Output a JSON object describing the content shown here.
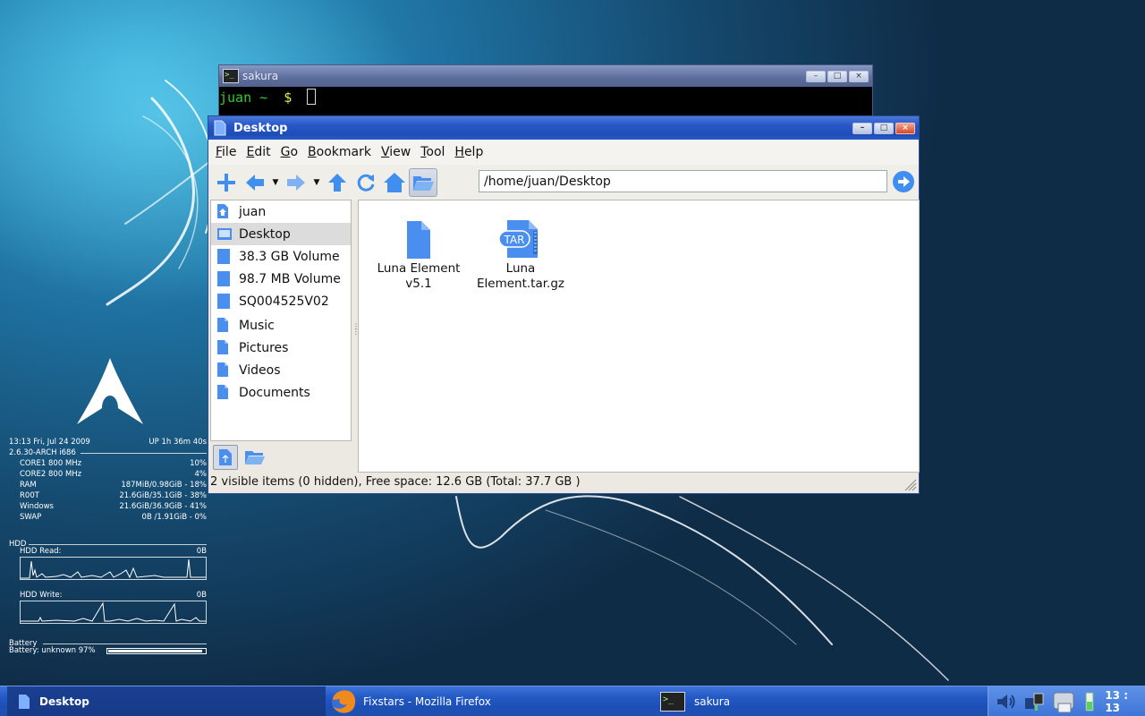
{
  "terminal": {
    "title": "sakura",
    "prompt_user": "juan",
    "prompt_path": "~",
    "prompt_symbol": "$"
  },
  "file_manager": {
    "title": "Desktop",
    "menu": [
      "File",
      "Edit",
      "Go",
      "Bookmark",
      "View",
      "Tool",
      "Help"
    ],
    "menu_mnemonics": [
      "F",
      "E",
      "G",
      "B",
      "V",
      "T",
      "H"
    ],
    "path": "/home/juan/Desktop",
    "sidebar": [
      {
        "label": "juan",
        "icon": "home-icon"
      },
      {
        "label": "Desktop",
        "icon": "desktop-icon",
        "selected": true
      },
      {
        "label": "38.3 GB Volume",
        "icon": "volume-icon"
      },
      {
        "label": "98.7 MB Volume",
        "icon": "volume-icon"
      },
      {
        "label": "SQ004525V02",
        "icon": "volume-icon"
      },
      {
        "label": "Music",
        "icon": "folder-icon"
      },
      {
        "label": "Pictures",
        "icon": "folder-icon"
      },
      {
        "label": "Videos",
        "icon": "folder-icon"
      },
      {
        "label": "Documents",
        "icon": "folder-icon"
      }
    ],
    "files": [
      {
        "name_line1": "Luna Element",
        "name_line2": "v5.1",
        "icon": "document-icon"
      },
      {
        "name_line1": "Luna",
        "name_line2": "Element.tar.gz",
        "icon": "tar-archive-icon",
        "badge": "TAR"
      }
    ],
    "status": "2 visible items (0 hidden), Free space: 12.6 GB (Total: 37.7 GB )"
  },
  "conky": {
    "time": "13:13 Fri, Jul 24 2009",
    "uptime": "UP 1h 36m 40s",
    "kernel": "2.6.30-ARCH i686",
    "rows": [
      {
        "label": "CORE1 800 MHz",
        "value": "10%"
      },
      {
        "label": "CORE2 800 MHz",
        "value": "4%"
      },
      {
        "label": "RAM",
        "value": "187MiB/0.98GiB - 18%"
      },
      {
        "label": "R00T",
        "value": "21.6GiB/35.1GiB - 38%"
      },
      {
        "label": "Windows",
        "value": "21.6GiB/36.9GiB - 41%"
      },
      {
        "label": "SWAP",
        "value": "0B  /1.91GiB - 0%"
      }
    ],
    "hdd_header": "HDD",
    "hdd_read_label": "HDD Read:",
    "hdd_read_value": "0B",
    "hdd_write_label": "HDD Write:",
    "hdd_write_value": "0B",
    "battery_header": "Battery",
    "battery_text": "Battery: unknown 97%",
    "battery_level": 0.97
  },
  "taskbar": {
    "tasks": [
      {
        "label": "Desktop",
        "active": true
      },
      {
        "label": "Fixstars - Mozilla Firefox"
      },
      {
        "label": "sakura"
      }
    ],
    "clock": "13 : 13"
  },
  "colors": {
    "titlebar_blue": "#2656c8",
    "icon_blue": "#4a8ff0",
    "taskbar_blue": "#245ac6"
  }
}
